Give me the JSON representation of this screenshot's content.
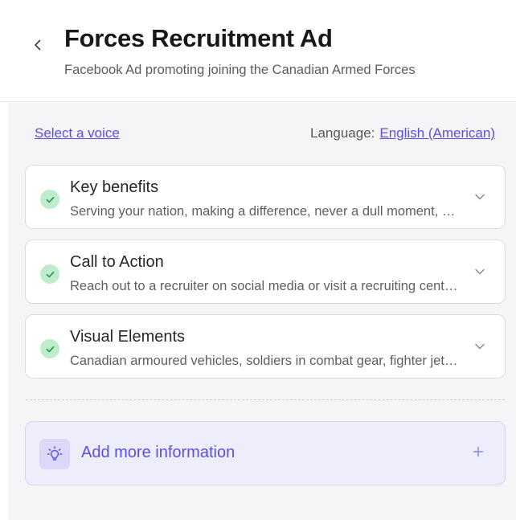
{
  "header": {
    "back_icon": "chevron-left-icon",
    "title": "Forces Recruitment Ad",
    "subtitle": "Facebook Ad promoting joining the Canadian Armed Forces"
  },
  "settings": {
    "voice_link": "Select a voice",
    "language_label": "Language:",
    "language_value": "English (American)"
  },
  "sections": [
    {
      "title": "Key benefits",
      "description": "Serving your nation, making a difference, never a dull moment, adventure and travel",
      "status": "complete",
      "status_icon": "check-icon",
      "toggle_icon": "chevron-down-icon"
    },
    {
      "title": "Call to Action",
      "description": "Reach out to a recruiter on social media or visit a recruiting centre near you",
      "status": "complete",
      "status_icon": "check-icon",
      "toggle_icon": "chevron-down-icon"
    },
    {
      "title": "Visual Elements",
      "description": "Canadian armoured vehicles, soldiers in combat gear, fighter jets, naval ships",
      "status": "complete",
      "status_icon": "check-icon",
      "toggle_icon": "chevron-down-icon"
    }
  ],
  "add_more": {
    "label": "Add more information",
    "icon": "lightbulb-icon",
    "action_icon": "plus-icon"
  },
  "colors": {
    "accent": "#5b4ee6",
    "success_bg": "#bfeccc",
    "success": "#2f9e55",
    "panel_bg": "#f5f5f7"
  }
}
